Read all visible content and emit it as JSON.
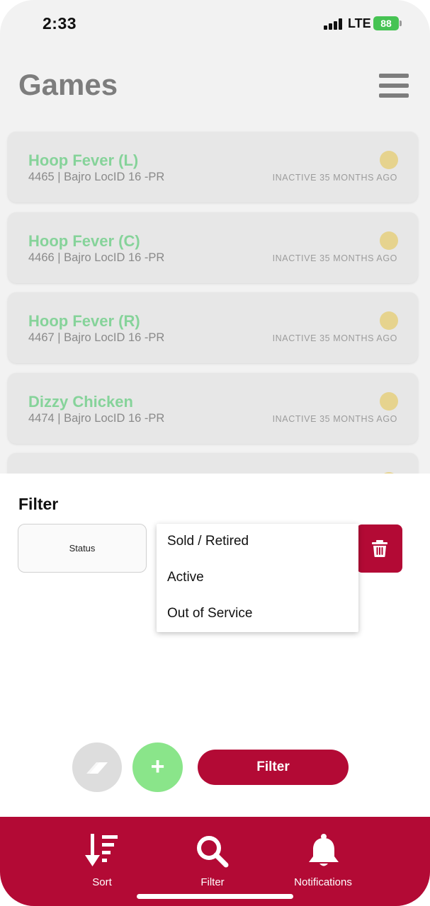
{
  "status_bar": {
    "time": "2:33",
    "network": "LTE",
    "battery": "88"
  },
  "header": {
    "title": "Games",
    "menu_icon": "hamburger-menu-icon"
  },
  "games": [
    {
      "name": "Hoop Fever (L)",
      "detail": "4465 | Bajro LocID 16 -PR",
      "status": "INACTIVE 35 MONTHS AGO"
    },
    {
      "name": "Hoop Fever (C)",
      "detail": "4466 | Bajro LocID 16 -PR",
      "status": "INACTIVE 35 MONTHS AGO"
    },
    {
      "name": "Hoop Fever (R)",
      "detail": "4467 | Bajro LocID 16 -PR",
      "status": "INACTIVE 35 MONTHS AGO"
    },
    {
      "name": "Dizzy Chicken",
      "detail": "4474 | Bajro LocID 16 -PR",
      "status": "INACTIVE 35 MONTHS AGO"
    }
  ],
  "filter_sheet": {
    "title": "Filter",
    "field_label": "Status",
    "dropdown_options": [
      "Sold / Retired",
      "Active",
      "Out of Service"
    ],
    "add_label": "+",
    "apply_label": "Filter"
  },
  "tabbar": {
    "items": [
      {
        "label": "Sort",
        "icon": "sort-icon"
      },
      {
        "label": "Filter",
        "icon": "search-icon"
      },
      {
        "label": "Notifications",
        "icon": "bell-icon"
      }
    ]
  },
  "colors": {
    "brand": "#b30a35",
    "game_name": "#86d39a",
    "status_dot": "#e6d38e",
    "add_button": "#8ae58a"
  }
}
